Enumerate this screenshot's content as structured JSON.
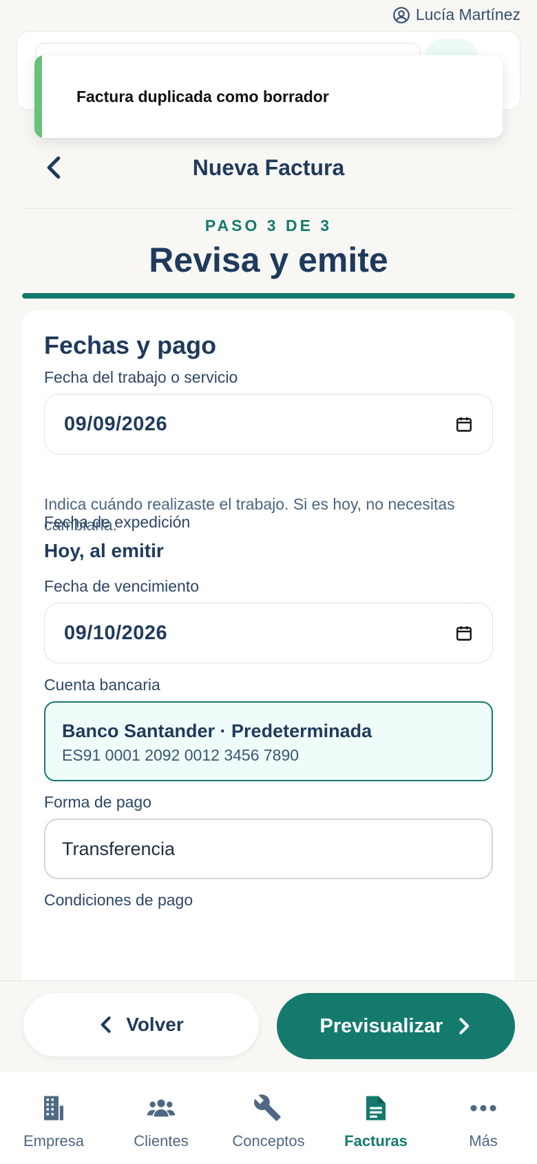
{
  "user": {
    "name": "Lucía Martínez",
    "icon": "user-circle-icon"
  },
  "toast": {
    "message": "Factura duplicada como borrador"
  },
  "header": {
    "title": "Nueva Factura",
    "back_icon": "chevron-left-icon"
  },
  "wizard": {
    "step_label": "PASO 3 DE 3",
    "title": "Revisa y emite",
    "progress": 1.0
  },
  "section": {
    "title": "Fechas y pago",
    "service_date": {
      "label": "Fecha del trabajo o servicio",
      "value": "09/09/2026",
      "help": "Indica cuándo realizaste el trabajo. Si es hoy, no necesitas cambiarla."
    },
    "issue_date": {
      "label": "Fecha de expedición",
      "value": "Hoy, al emitir"
    },
    "due_date": {
      "label": "Fecha de vencimiento",
      "value": "09/10/2026"
    },
    "bank_account": {
      "label": "Cuenta bancaria",
      "name": "Banco Santander · Predeterminada",
      "iban": "ES91 0001 2092 0012 3456 7890"
    },
    "payment_method": {
      "label": "Forma de pago",
      "value": "Transferencia"
    },
    "payment_terms": {
      "label": "Condiciones de pago"
    }
  },
  "actions": {
    "back_label": "Volver",
    "next_label": "Previsualizar"
  },
  "nav": {
    "items": [
      {
        "label": "Empresa",
        "icon": "building-icon"
      },
      {
        "label": "Clientes",
        "icon": "users-icon"
      },
      {
        "label": "Conceptos",
        "icon": "wrench-icon"
      },
      {
        "label": "Facturas",
        "icon": "document-icon",
        "active": true
      },
      {
        "label": "Más",
        "icon": "more-dots-icon"
      }
    ]
  },
  "colors": {
    "accent": "#147a6e",
    "title": "#1f3a5c",
    "toast_stripe": "#66c27a",
    "bank_bg": "#effcf9"
  }
}
